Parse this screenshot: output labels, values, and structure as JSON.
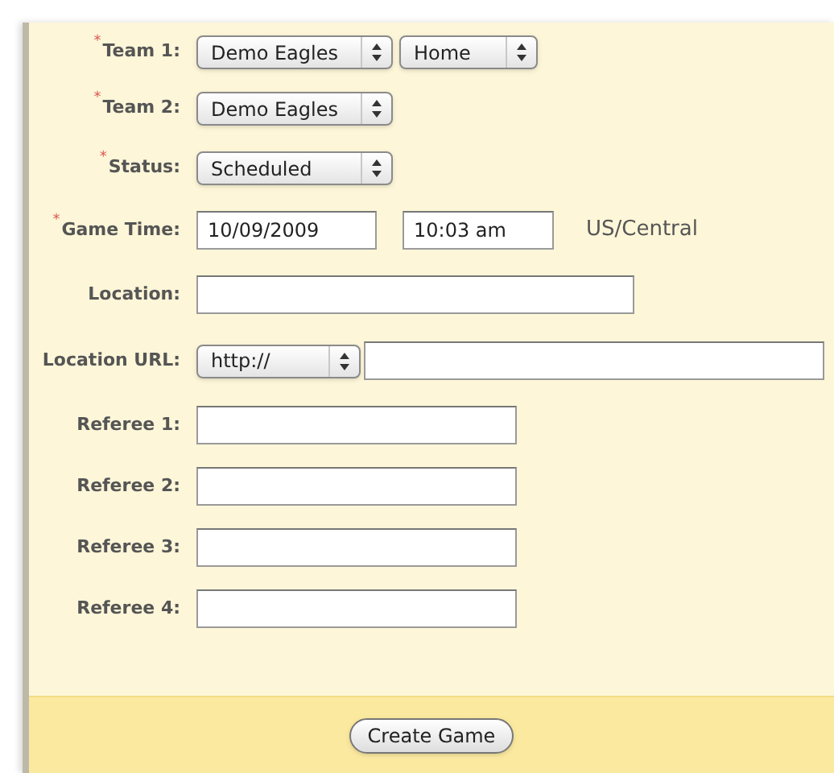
{
  "fields": [
    {
      "label": "Team 1:",
      "marker": "*",
      "controls": [
        {
          "kind": "select",
          "value": "Demo Eagles"
        },
        {
          "kind": "select",
          "value": "Home"
        }
      ]
    },
    {
      "label": "Team 2:",
      "marker": "*",
      "controls": [
        {
          "kind": "select",
          "value": "Demo Eagles"
        }
      ]
    },
    {
      "label": "Status:",
      "marker": "*",
      "controls": [
        {
          "kind": "select",
          "value": "Scheduled"
        }
      ]
    },
    {
      "label": "Game Time:",
      "marker": "*",
      "controls": [
        {
          "kind": "text",
          "value": "10/09/2009"
        },
        {
          "kind": "text",
          "value": "10:03 am"
        },
        {
          "kind": "note",
          "value": "US/Central"
        }
      ]
    },
    {
      "label": "Location:",
      "controls": [
        {
          "kind": "text"
        }
      ]
    },
    {
      "label": "Location URL:",
      "controls": [
        {
          "kind": "select",
          "value": "http://"
        },
        {
          "kind": "text"
        }
      ]
    },
    {
      "label": "Referee 1:",
      "controls": [
        {
          "kind": "text"
        }
      ]
    },
    {
      "label": "Referee 2:",
      "controls": [
        {
          "kind": "text"
        }
      ]
    },
    {
      "label": "Referee 3:",
      "controls": [
        {
          "kind": "text"
        }
      ]
    },
    {
      "label": "Referee 4:",
      "controls": [
        {
          "kind": "text"
        }
      ]
    }
  ],
  "submit": "Create Game"
}
